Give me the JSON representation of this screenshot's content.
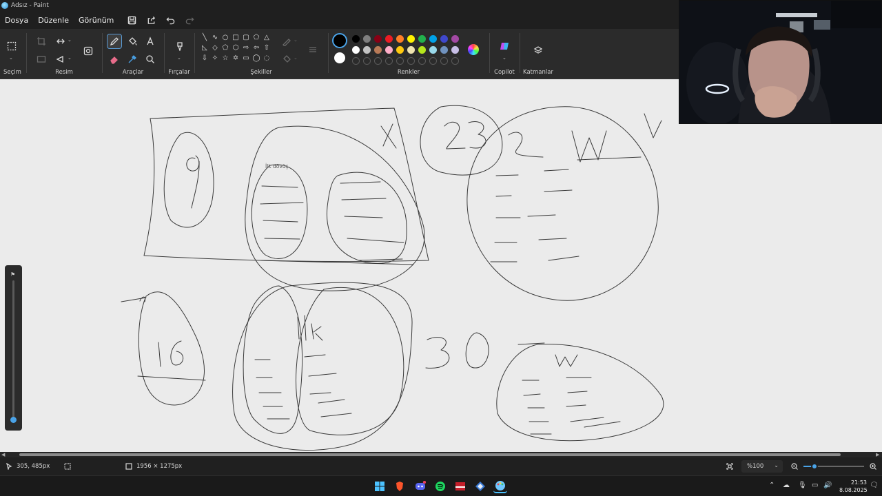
{
  "window": {
    "title": "Adsız - Paint"
  },
  "menu": {
    "file": "Dosya",
    "edit": "Düzenle",
    "view": "Görünüm"
  },
  "ribbon": {
    "selection": "Seçim",
    "image": "Resim",
    "tools": "Araçlar",
    "brushes": "Fırçalar",
    "shapes": "Şekiller",
    "colors": "Renkler",
    "copilot": "Copilot",
    "layers": "Katmanlar"
  },
  "palette": {
    "row1": [
      "#000000",
      "#7f7f7f",
      "#880015",
      "#ed1c24",
      "#ff7f27",
      "#fff200",
      "#22b14c",
      "#00a2e8",
      "#3f48cc",
      "#a349a4"
    ],
    "row2": [
      "#ffffff",
      "#c3c3c3",
      "#b97a57",
      "#ffaec9",
      "#ffc90e",
      "#efe4b0",
      "#b5e61d",
      "#99d9ea",
      "#7092be",
      "#c8bfe7"
    ],
    "primary": "#000000",
    "secondary": "#ffffff",
    "accent": "#4aa3e8"
  },
  "canvas": {
    "label": "İlk dövüş",
    "sketch_text": [
      "9",
      "İlk",
      "X",
      "23",
      "2",
      "W",
      "16",
      "İlk",
      "30",
      "W"
    ]
  },
  "status": {
    "cursor_pos": "305, 485px",
    "canvas_size": "1956 × 1275px",
    "zoom": "%100"
  },
  "clock": {
    "time": "21:53",
    "date": "8.08.2025"
  }
}
